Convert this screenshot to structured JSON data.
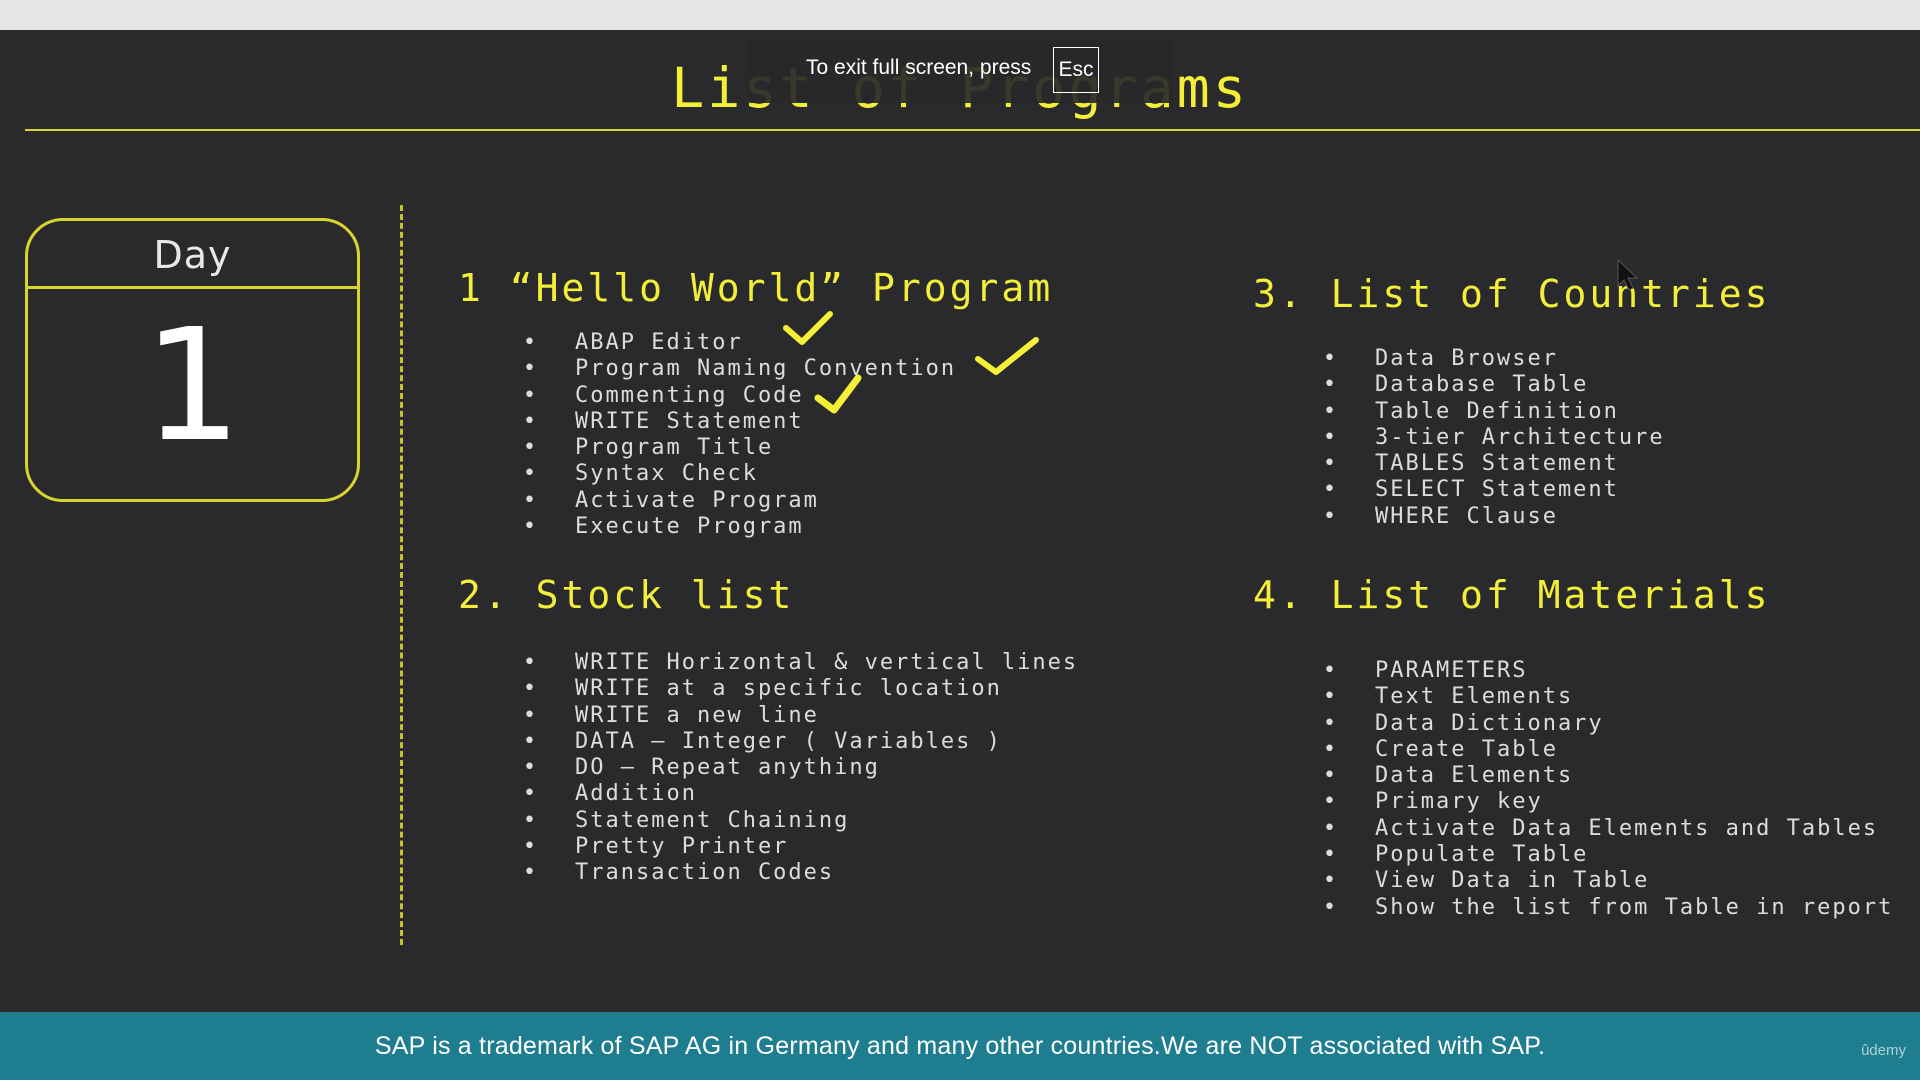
{
  "slide": {
    "title": "List of Programs",
    "day_label": "Day",
    "day_number": "1"
  },
  "fullscreen_notice": {
    "text": "To exit full screen, press",
    "key": "Esc"
  },
  "sections": [
    {
      "heading": "1 “Hello World” Program",
      "items": [
        "ABAP Editor",
        "Program Naming Convention",
        "Commenting Code",
        "WRITE Statement",
        "Program Title",
        "Syntax Check",
        "Activate Program",
        "Execute Program"
      ]
    },
    {
      "heading": "2. Stock list",
      "items": [
        "WRITE Horizontal & vertical lines",
        "WRITE at a specific location",
        "WRITE a new line",
        "DATA – Integer ( Variables )",
        "DO – Repeat anything",
        "Addition",
        "Statement Chaining",
        "Pretty Printer",
        "Transaction Codes"
      ]
    },
    {
      "heading": "3. List of Countries",
      "items": [
        "Data Browser",
        "Database Table",
        "Table Definition",
        "3-tier Architecture",
        "TABLES Statement",
        "SELECT Statement",
        "WHERE Clause"
      ]
    },
    {
      "heading": "4. List of Materials",
      "items": [
        "PARAMETERS",
        "Text Elements",
        "Data Dictionary",
        "Create Table",
        "Data Elements",
        "Primary key",
        "Activate Data Elements and Tables",
        "Populate Table",
        "View Data in Table",
        "Show the list from Table in report"
      ]
    }
  ],
  "bullet": "•",
  "footer": {
    "notice": "SAP is a trademark of SAP AG in Germany and many other countries.We are NOT associated with SAP.",
    "brand": "ûdemy"
  },
  "colors": {
    "accent": "#f2ee3a",
    "background": "#2a2a2c",
    "footer": "#1e7d8f"
  },
  "icons": [
    "checkmark-icon",
    "mouse-pointer-icon"
  ]
}
